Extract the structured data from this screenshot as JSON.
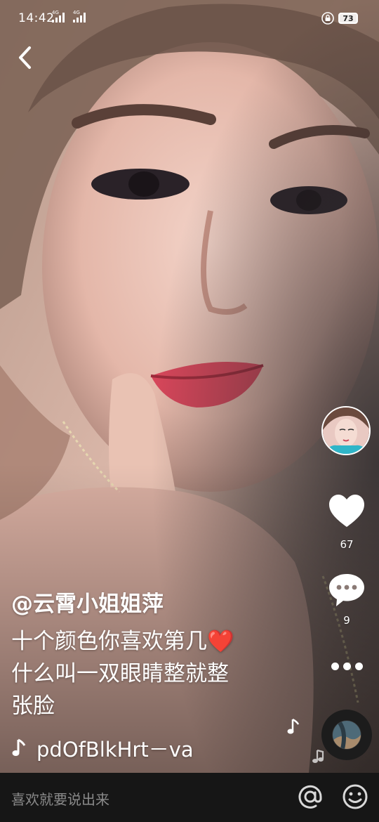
{
  "status_bar": {
    "time": "14:42",
    "signal_1_tag": "4G",
    "signal_2_tag": "4G",
    "battery": "73"
  },
  "video": {
    "author": "@云霄小姐姐萍",
    "caption_line_1": "十个颜色你喜欢第几❤️",
    "caption_line_2": "什么叫一双眼睛整就整",
    "caption_line_3": "张脸",
    "music": "pdOfBlkHrt－va"
  },
  "actions": {
    "like_count": "67",
    "comment_count": "9"
  },
  "comment_bar": {
    "placeholder": "喜欢就要说出来"
  },
  "icons": {
    "back": "back-arrow-icon",
    "like": "heart-icon",
    "comment": "speech-bubble-icon",
    "more": "more-dots-icon",
    "music": "music-note-icon",
    "at": "at-sign-icon",
    "emoji": "smiley-icon",
    "lock": "lock-rotation-icon"
  },
  "colors": {
    "heart_emoji": "#e0202a",
    "comment_bar": "#161616",
    "placeholder": "#8a8a8a"
  }
}
